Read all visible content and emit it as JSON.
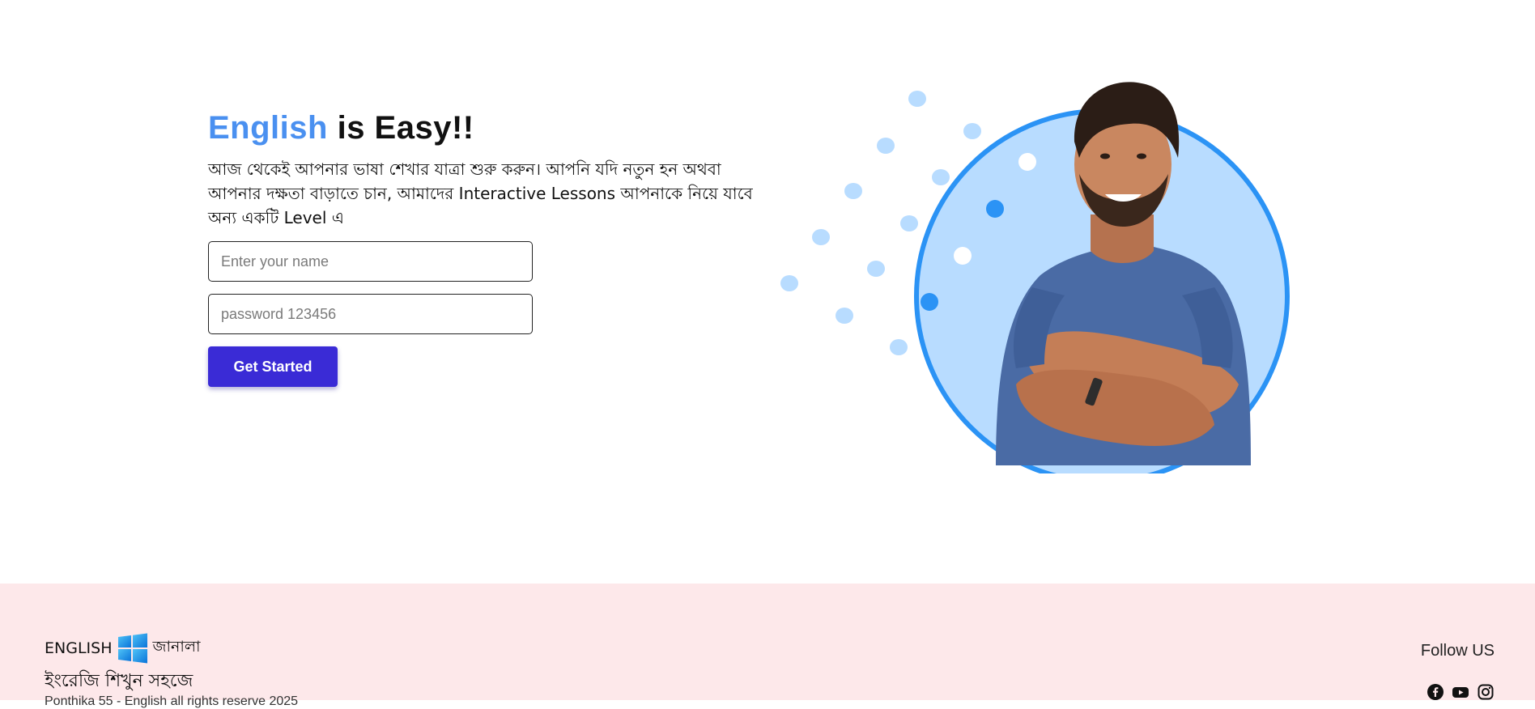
{
  "hero": {
    "headline_accent": "English",
    "headline_rest": "is Easy!!",
    "lead_text": "আজ থেকেই আপনার ভাষা শেখার যাত্রা শুরু করুন। আপনি যদি নতুন হন অথবা আপনার দক্ষতা বাড়াতে চান, আমাদের Interactive Lessons আপনাকে নিয়ে যাবে অন্য একটি Level এ",
    "name_placeholder": "Enter your name",
    "password_placeholder": "password 123456",
    "cta_label": "Get Started"
  },
  "footer": {
    "brand_prefix": "ENGLISH",
    "brand_suffix": "জানালা",
    "brand_logo_icon": "windows-logo-icon",
    "tagline": "ইংরেজি শিখুন সহজে",
    "copyright": "Ponthika 55 - English all rights reserve 2025",
    "follow_label": "Follow US",
    "social": [
      {
        "icon": "facebook-icon"
      },
      {
        "icon": "youtube-icon"
      },
      {
        "icon": "instagram-icon"
      }
    ]
  },
  "colors": {
    "accent_blue": "#4a90f0",
    "button_purple": "#3a2bd6",
    "circle_fill": "#b8dcff",
    "circle_ring": "#2b93f5",
    "footer_bg": "#fde8ea"
  }
}
